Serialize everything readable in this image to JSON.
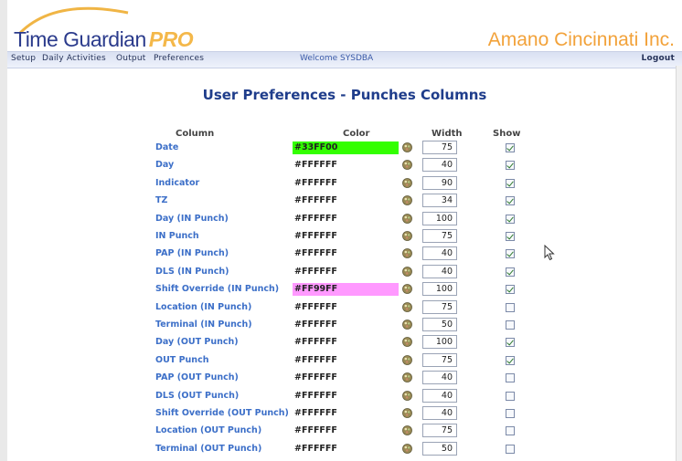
{
  "app": {
    "logo_main": "Time Guardian",
    "logo_pro": "PRO",
    "company": "Amano Cincinnati Inc."
  },
  "nav": {
    "items": [
      "Setup",
      "Daily Activities",
      "Output",
      "Preferences"
    ],
    "welcome": "Welcome SYSDBA",
    "logout": "Logout"
  },
  "page": {
    "title": "User Preferences - Punches Columns",
    "headers": {
      "column": "Column",
      "color": "Color",
      "width": "Width",
      "show": "Show"
    }
  },
  "rows": [
    {
      "name": "Date",
      "color": "#33FF00",
      "width": "75",
      "show": true
    },
    {
      "name": "Day",
      "color": "#FFFFFF",
      "width": "40",
      "show": true
    },
    {
      "name": "Indicator",
      "color": "#FFFFFF",
      "width": "90",
      "show": true
    },
    {
      "name": "TZ",
      "color": "#FFFFFF",
      "width": "34",
      "show": true
    },
    {
      "name": "Day (IN Punch)",
      "color": "#FFFFFF",
      "width": "100",
      "show": true
    },
    {
      "name": "IN Punch",
      "color": "#FFFFFF",
      "width": "75",
      "show": true
    },
    {
      "name": "PAP (IN Punch)",
      "color": "#FFFFFF",
      "width": "40",
      "show": true
    },
    {
      "name": "DLS (IN Punch)",
      "color": "#FFFFFF",
      "width": "40",
      "show": true
    },
    {
      "name": "Shift Override (IN Punch)",
      "color": "#FF99FF",
      "width": "100",
      "show": true
    },
    {
      "name": "Location (IN Punch)",
      "color": "#FFFFFF",
      "width": "75",
      "show": false
    },
    {
      "name": "Terminal (IN Punch)",
      "color": "#FFFFFF",
      "width": "50",
      "show": false
    },
    {
      "name": "Day (OUT Punch)",
      "color": "#FFFFFF",
      "width": "100",
      "show": true
    },
    {
      "name": "OUT Punch",
      "color": "#FFFFFF",
      "width": "75",
      "show": true
    },
    {
      "name": "PAP (OUT Punch)",
      "color": "#FFFFFF",
      "width": "40",
      "show": false
    },
    {
      "name": "DLS (OUT Punch)",
      "color": "#FFFFFF",
      "width": "40",
      "show": false
    },
    {
      "name": "Shift Override (OUT Punch)",
      "color": "#FFFFFF",
      "width": "40",
      "show": false
    },
    {
      "name": "Location (OUT Punch)",
      "color": "#FFFFFF",
      "width": "75",
      "show": false
    },
    {
      "name": "Terminal (OUT Punch)",
      "color": "#FFFFFF",
      "width": "50",
      "show": false
    }
  ],
  "colors": {
    "highlight_green": "#33FF00",
    "highlight_pink": "#FF99FF",
    "accent": "#3c6fc8"
  }
}
